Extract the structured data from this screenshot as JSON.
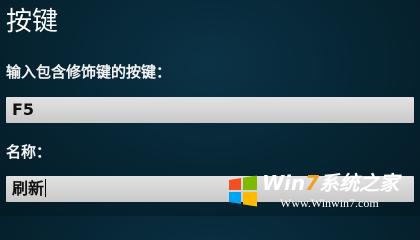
{
  "page": {
    "title": "按键"
  },
  "shortcut": {
    "label": "输入包含修饰键的按键：",
    "value": "F5"
  },
  "name": {
    "label": "名称：",
    "value": "刷新"
  },
  "watermark": {
    "brand_prefix": "Win",
    "brand_digit": "7",
    "brand_suffix": "系统之家",
    "url": "Www.Winwin7.com",
    "accent_color": "#f0a020"
  }
}
